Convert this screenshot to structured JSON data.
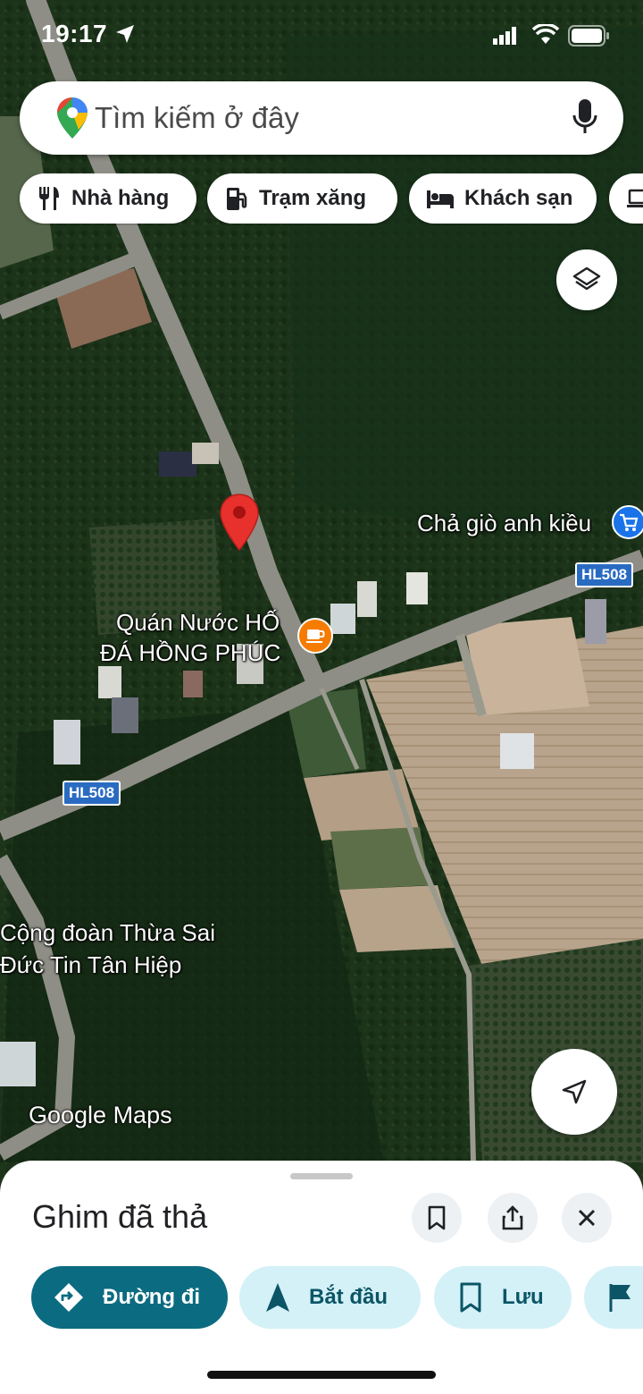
{
  "status_bar": {
    "time": "19:17"
  },
  "search": {
    "placeholder": "Tìm kiếm ở đây"
  },
  "chips": [
    {
      "label": "Nhà hàng",
      "icon": "restaurant-icon"
    },
    {
      "label": "Trạm xăng",
      "icon": "gas-station-icon"
    },
    {
      "label": "Khách sạn",
      "icon": "hotel-icon"
    }
  ],
  "map": {
    "places": [
      {
        "name": "Chả giò anh kiều",
        "icon": "shopping-cart-icon"
      },
      {
        "name_line1": "Quán Nước HỐ",
        "name_line2": "ĐÁ HỒNG PHÚC",
        "icon": "cafe-icon"
      },
      {
        "name_line1": "Cộng đoàn Thừa Sai",
        "name_line2": "Đức Tin Tân Hiệp"
      }
    ],
    "road_labels": [
      "HL508",
      "HL508"
    ],
    "watermark": "Google Maps"
  },
  "sheet": {
    "title": "Ghim đã thả",
    "actions": [
      {
        "label": "Đường đi",
        "icon": "directions-icon"
      },
      {
        "label": "Bắt đầu",
        "icon": "navigation-arrow-icon"
      },
      {
        "label": "Lưu",
        "icon": "bookmark-icon"
      }
    ]
  },
  "colors": {
    "accent": "#0b6b81",
    "chip_bg": "#d4f1f7",
    "pin": "#e8302c"
  }
}
